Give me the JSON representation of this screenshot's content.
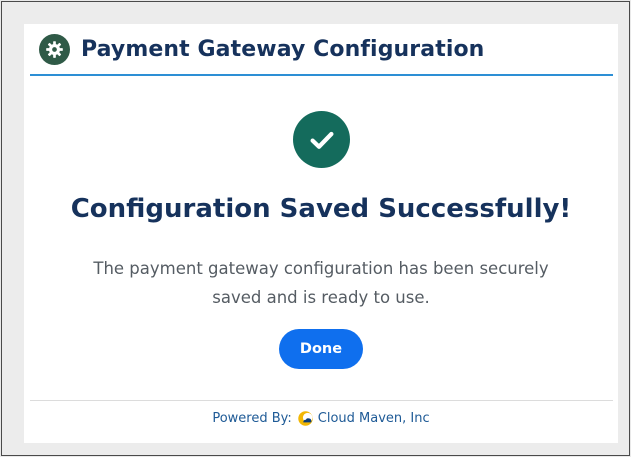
{
  "header": {
    "icon": "gear-icon",
    "title": "Payment Gateway Configuration",
    "accent_color": "#2d8fd5"
  },
  "status": {
    "icon": "check-circle-icon",
    "title": "Configuration Saved Successfully!",
    "message": "The payment gateway configuration has been securely saved and is ready to use."
  },
  "actions": {
    "done_label": "Done"
  },
  "footer": {
    "powered_by_label": "Powered By:",
    "brand_icon": "cloud-maven-logo-icon",
    "brand_name": "Cloud Maven, Inc"
  },
  "colors": {
    "title_text": "#16325c",
    "success_badge": "#146b5c",
    "gear_badge": "#2f5a47",
    "primary_button": "#0f6fee",
    "link_text": "#1e5a96"
  }
}
